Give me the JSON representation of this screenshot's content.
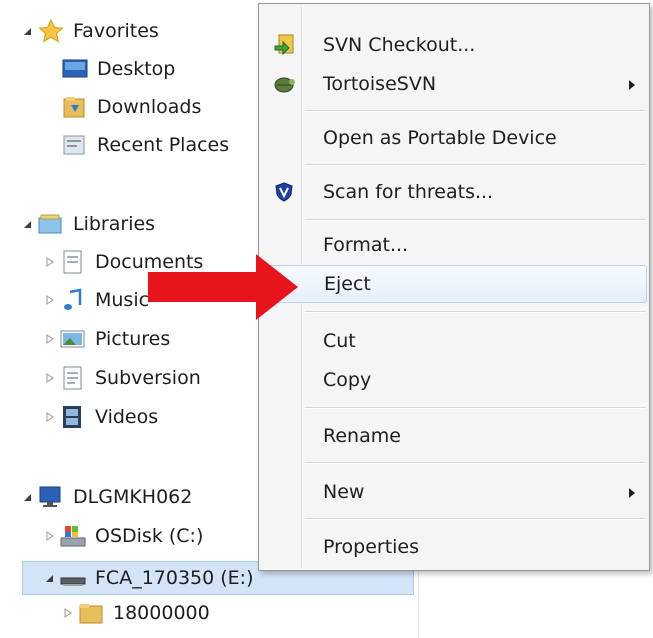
{
  "nav_tree": {
    "favorites": {
      "label": "Favorites",
      "items": [
        {
          "label": "Desktop"
        },
        {
          "label": "Downloads"
        },
        {
          "label": "Recent Places"
        }
      ]
    },
    "libraries": {
      "label": "Libraries",
      "items": [
        {
          "label": "Documents"
        },
        {
          "label": "Music"
        },
        {
          "label": "Pictures"
        },
        {
          "label": "Subversion"
        },
        {
          "label": "Videos"
        }
      ]
    },
    "computer": {
      "label": "DLGMKH062",
      "items": [
        {
          "label": "OSDisk (C:)"
        },
        {
          "label": "FCA_170350 (E:)",
          "selected": true
        },
        {
          "label": "18000000"
        }
      ]
    }
  },
  "context_menu": {
    "items": [
      {
        "label": "SVN Checkout...",
        "icon": "svn-checkout-icon"
      },
      {
        "label": "TortoiseSVN",
        "icon": "tortoisesvn-icon",
        "submenu": true
      },
      {
        "label": "Open as Portable Device"
      },
      {
        "label": "Scan for threats...",
        "icon": "shield-icon"
      },
      {
        "label": "Format..."
      },
      {
        "label": "Eject",
        "hovered": true
      },
      {
        "label": "Cut"
      },
      {
        "label": "Copy"
      },
      {
        "label": "Rename"
      },
      {
        "label": "New",
        "submenu": true
      },
      {
        "label": "Properties"
      }
    ]
  },
  "annotation": {
    "arrow_color": "#e8141b",
    "points_to": "Eject"
  },
  "colors": {
    "selection": "#d3e4f7",
    "menu_background": "#f5f5f5"
  }
}
